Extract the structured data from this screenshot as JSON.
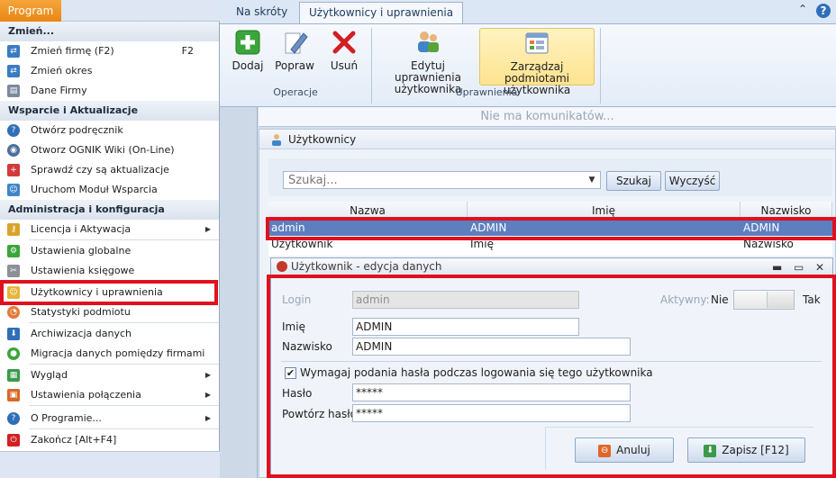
{
  "menu": {
    "program_button": "Program",
    "sections": [
      {
        "header": "Zmień...",
        "items": [
          {
            "label": "Zmień firmę (F2)",
            "shortcut": "F2",
            "icon": "switch-company-icon"
          },
          {
            "label": "Zmień okres",
            "icon": "switch-period-icon"
          },
          {
            "label": "Dane Firmy",
            "icon": "company-data-icon"
          }
        ]
      },
      {
        "header": "Wsparcie i Aktualizacje",
        "items": [
          {
            "label": "Otwórz podręcznik",
            "icon": "help-manual-icon"
          },
          {
            "label": "Otworz OGNIK Wiki (On-Line)",
            "icon": "wiki-icon"
          },
          {
            "label": "Sprawdź czy są aktualizacje",
            "icon": "update-icon"
          },
          {
            "label": "Uruchom Moduł Wsparcia",
            "icon": "support-icon"
          }
        ]
      },
      {
        "header": "Administracja i konfiguracja",
        "items": [
          {
            "label": "Licencja i Aktywacja",
            "icon": "license-key-icon"
          },
          {
            "label": "Ustawienia globalne",
            "icon": "global-settings-icon"
          },
          {
            "label": "Ustawienia księgowe",
            "icon": "accounting-settings-icon"
          },
          {
            "label": "Użytkownicy i uprawnienia",
            "icon": "users-permissions-icon"
          },
          {
            "label": "Statystyki podmiotu",
            "icon": "statistics-icon"
          },
          {
            "label": "Archiwizacja danych",
            "icon": "archive-icon"
          },
          {
            "label": "Migracja danych pomiędzy firmami",
            "icon": "migration-icon"
          },
          {
            "label": "Wygląd",
            "icon": "appearance-icon"
          },
          {
            "label": "Ustawienia połączenia",
            "icon": "connection-settings-icon"
          },
          {
            "label": "O Programie...",
            "icon": "about-icon"
          },
          {
            "label": "Zakończ [Alt+F4]",
            "icon": "exit-icon"
          }
        ]
      }
    ]
  },
  "ribbon": {
    "tabs": [
      "Na skróty",
      "Użytkownicy i uprawnienia"
    ],
    "active_tab": "Użytkownicy i uprawnienia",
    "groups": [
      {
        "label": "Operacje",
        "buttons": [
          "Dodaj",
          "Popraw",
          "Usuń"
        ]
      },
      {
        "label": "Uprawnienia",
        "buttons": [
          "Edytuj uprawnienia użytkownika",
          "Zarządzaj podmiotami użytkownika"
        ]
      }
    ],
    "help": "?",
    "collapse": "⌃"
  },
  "message_bar": "Nie ma komunikatów...",
  "panel": {
    "title": "Użytkownicy",
    "search": {
      "placeholder": "Szukaj...",
      "search_button": "Szukaj",
      "clear_button": "Wyczyść"
    },
    "grid": {
      "columns": [
        "Nazwa",
        "Imię",
        "Nazwisko"
      ],
      "rows": [
        [
          "admin",
          "ADMIN",
          "ADMIN"
        ],
        [
          "Użytkownik",
          "Imię",
          "Nazwisko"
        ]
      ],
      "selected_row": 0
    }
  },
  "dialog": {
    "title": "Użytkownik - edycja danych",
    "controls": {
      "minimize": "▬",
      "maximize": "▭",
      "close": "✕"
    },
    "login_label": "Login",
    "login_value": "admin",
    "active_label": "Aktywny:",
    "active_no": "Nie",
    "active_yes": "Tak",
    "first_name_label": "Imię",
    "first_name_value": "ADMIN",
    "last_name_label": "Nazwisko",
    "last_name_value": "ADMIN",
    "require_password_label": "Wymagaj podania hasła podczas logowania się tego użytkownika",
    "require_password_checked": true,
    "password_label": "Hasło",
    "password_value": "*****",
    "repeat_password_label": "Powtórz hasło",
    "repeat_password_value": "*****",
    "cancel_button": "Anuluj",
    "save_button": "Zapisz [F12]"
  },
  "colors": {
    "highlight_box": "#e0101e",
    "selected_row": "#5d7fbf",
    "program_button": "#e88615"
  }
}
